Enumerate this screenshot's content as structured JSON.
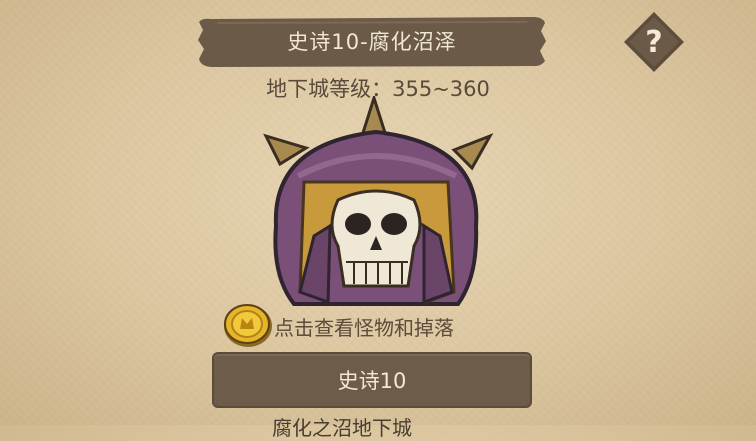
{
  "header": {
    "title": "史诗10-腐化沼泽",
    "help_label": "?"
  },
  "dungeon": {
    "level_label": "地下城等级：355~360"
  },
  "rewards": {
    "view_label": "点击查看怪物和掉落",
    "coin_icon": "gold-coin-icon"
  },
  "difficulty": {
    "button_label": "史诗10"
  },
  "footer": {
    "partial_text": "腐化之沼地下城"
  },
  "colors": {
    "banner": "#6b5a48",
    "button": "#6d5c4a",
    "helmet_purple": "#7a4f78",
    "helmet_gold": "#c89a3c"
  }
}
